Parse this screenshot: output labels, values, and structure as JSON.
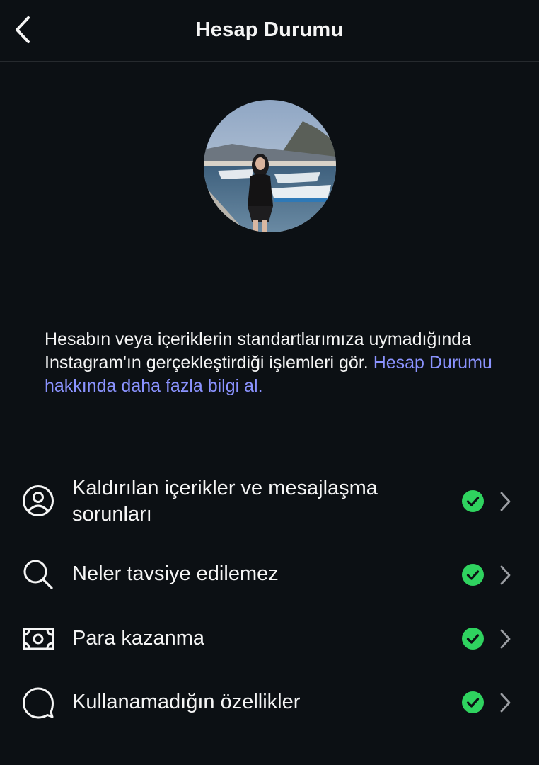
{
  "header": {
    "title": "Hesap Durumu"
  },
  "description": {
    "text": "Hesabın veya içeriklerin standartlarımıza uymadığında Instagram'ın gerçekleştirdiği işlemleri gör. ",
    "link": "Hesap Durumu hakkında daha fazla bilgi al."
  },
  "items": [
    {
      "label": "Kaldırılan içerikler ve mesajlaşma sorunları",
      "icon": "user-circle-icon",
      "status": "ok"
    },
    {
      "label": "Neler tavsiye edilemez",
      "icon": "search-icon",
      "status": "ok"
    },
    {
      "label": "Para kazanma",
      "icon": "banknote-icon",
      "status": "ok"
    },
    {
      "label": "Kullanamadığın özellikler",
      "icon": "chat-bubble-icon",
      "status": "ok"
    }
  ],
  "colors": {
    "background": "#0c1014",
    "text": "#f5f5f5",
    "link": "#8b93ff",
    "success": "#2fd35f"
  }
}
